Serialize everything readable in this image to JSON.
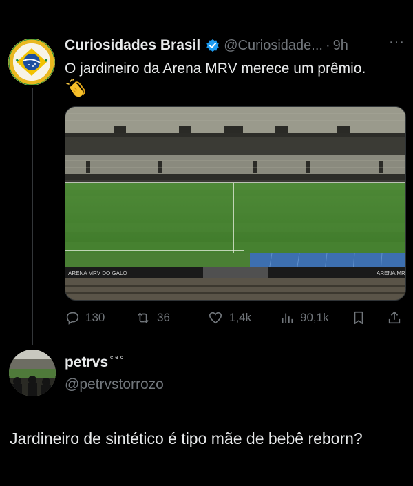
{
  "tweet": {
    "display_name": "Curiosidades Brasil",
    "handle": "@Curiosidade...",
    "separator": "·",
    "time": "9h",
    "more_label": "···",
    "text": "O jardineiro da Arena MRV merece um prêmio.",
    "emoji": "clapping-hands",
    "avatar_text_top": "CURIOSIDADES",
    "avatar_text_bottom": "BRASIL",
    "media": {
      "description": "stadium-pitch",
      "board_left": "ARENA MRV DO GALO",
      "board_right": "ARENA MR"
    },
    "actions": {
      "replies": "130",
      "retweets": "36",
      "likes": "1,4k",
      "views": "90,1k"
    }
  },
  "reply": {
    "display_name": "petrvs",
    "name_suffix": "ᶜᵉᶜ",
    "handle": "@petrvstorrozo",
    "text": "Jardineiro de sintético é tipo mãe de bebê reborn?"
  },
  "colors": {
    "background": "#000000",
    "primary_text": "#e7e9ea",
    "secondary_text": "#71767b",
    "verified": "#1d9bf0"
  }
}
